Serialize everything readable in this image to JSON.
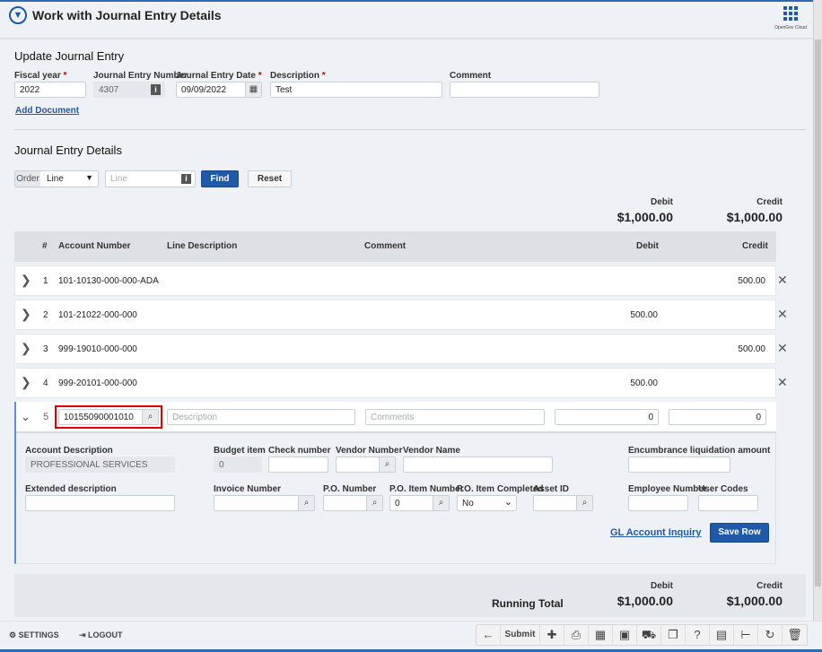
{
  "header": {
    "title": "Work with Journal Entry Details",
    "brand": "OpenGov Cloud"
  },
  "update": {
    "title": "Update Journal Entry",
    "fiscal_year": {
      "label": "Fiscal year",
      "value": "2022"
    },
    "je_number": {
      "label": "Journal Entry Number",
      "value": "4307"
    },
    "je_date": {
      "label": "Journal Entry Date",
      "value": "09/09/2022"
    },
    "description": {
      "label": "Description",
      "value": "Test"
    },
    "comment": {
      "label": "Comment",
      "value": ""
    },
    "add_document": "Add Document"
  },
  "details": {
    "title": "Journal Entry Details",
    "order_label": "Order",
    "order_value": "Line",
    "line_placeholder": "Line",
    "find": "Find",
    "reset": "Reset",
    "totals": {
      "debit_label": "Debit",
      "debit": "$1,000.00",
      "credit_label": "Credit",
      "credit": "$1,000.00"
    },
    "columns": [
      "#",
      "Account Number",
      "Line Description",
      "Comment",
      "Debit",
      "Credit"
    ],
    "rows": [
      {
        "n": "1",
        "account": "101-10130-000-000-ADA",
        "debit": "",
        "credit": "500.00"
      },
      {
        "n": "2",
        "account": "101-21022-000-000",
        "debit": "500.00",
        "credit": ""
      },
      {
        "n": "3",
        "account": "999-19010-000-000",
        "debit": "",
        "credit": "500.00"
      },
      {
        "n": "4",
        "account": "999-20101-000-000",
        "debit": "500.00",
        "credit": ""
      }
    ],
    "edit_row": {
      "n": "5",
      "account": "10155090001010",
      "desc_placeholder": "Description",
      "comment_placeholder": "Comments",
      "debit": "0",
      "credit": "0",
      "account_description": {
        "label": "Account Description",
        "value": "PROFESSIONAL SERVICES"
      },
      "budget_item": {
        "label": "Budget item",
        "value": "0"
      },
      "check_number": "Check number",
      "vendor_number": "Vendor Number",
      "vendor_name": "Vendor Name",
      "encumbrance": "Encumbrance liquidation amount",
      "extended_description": "Extended description",
      "invoice_number": "Invoice Number",
      "po_number": "P.O. Number",
      "po_item_number": {
        "label": "P.O. Item Number",
        "value": "0"
      },
      "po_item_completed": {
        "label": "P.O. Item Completed",
        "value": "No"
      },
      "asset_id": "Asset ID",
      "employee_number": "Employee Number",
      "user_codes": "User Codes",
      "gl_inquiry": "GL Account Inquiry",
      "save_row": "Save Row"
    },
    "running": {
      "label": "Running Total",
      "debit_label": "Debit",
      "debit": "$1,000.00",
      "credit_label": "Credit",
      "credit": "$1,000.00"
    }
  },
  "footer": {
    "settings": "SETTINGS",
    "logout": "LOGOUT",
    "submit": "Submit"
  },
  "colors": {
    "accent": "#1e5aa8",
    "highlight": "#e00000"
  }
}
